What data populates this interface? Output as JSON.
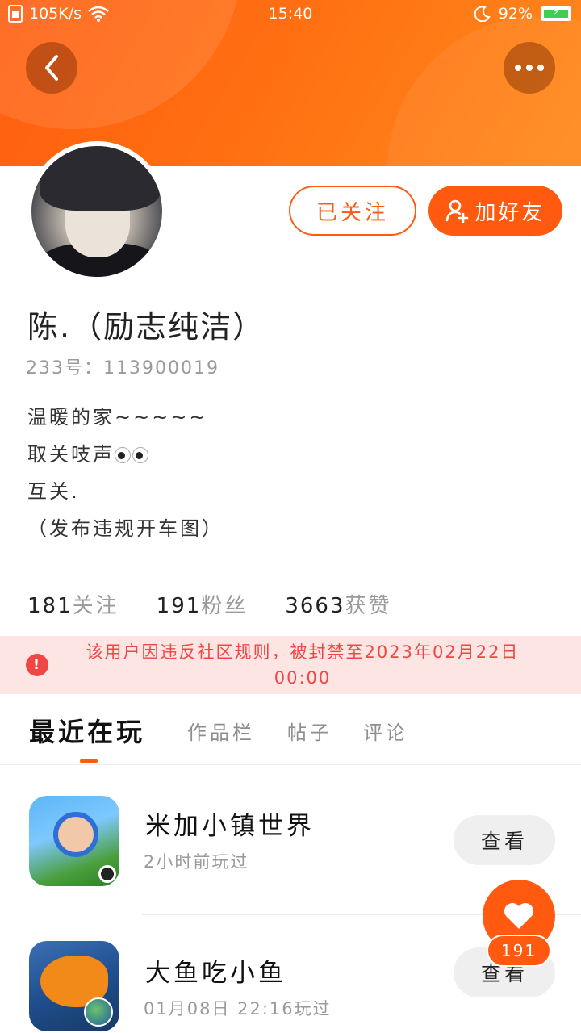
{
  "status_bar": {
    "net_speed": "105K/s",
    "time": "15:40",
    "battery": "92%"
  },
  "header": {
    "back_icon": "chevron-left-icon",
    "more_icon": "more-dots-icon"
  },
  "profile": {
    "avatar": "avatar",
    "followed_label": "已关注",
    "add_friend_label": "加好友",
    "add_friend_icon": "user-plus-icon",
    "nickname": "陈.（励志纯洁）",
    "uid": "233号：113900019",
    "bio": [
      "温暖的家~~~~~",
      "取关吱声",
      "互关.",
      "（发布违规开车图）"
    ]
  },
  "stats": [
    {
      "num": "181",
      "label": "关注"
    },
    {
      "num": "191",
      "label": "粉丝"
    },
    {
      "num": "3663",
      "label": "获赞"
    }
  ],
  "ban_notice": {
    "icon": "alert-icon",
    "text": "该用户因违反社区规则，被封禁至2023年02月22日 00:00"
  },
  "tabs": [
    {
      "label": "最近在玩",
      "active": true
    },
    {
      "label": "作品栏",
      "active": false
    },
    {
      "label": "帖子",
      "active": false
    },
    {
      "label": "评论",
      "active": false
    }
  ],
  "games": [
    {
      "title": "米加小镇世界",
      "subtitle": "2小时前玩过",
      "button": "查看"
    },
    {
      "title": "大鱼吃小鱼",
      "subtitle": "01月08日 22:16玩过",
      "button": "查看"
    }
  ],
  "like": {
    "icon": "heart-icon",
    "count": "191"
  },
  "colors": {
    "accent": "#ff5a0f",
    "ban_bg": "#fde5e3",
    "ban_text": "#f04646"
  }
}
